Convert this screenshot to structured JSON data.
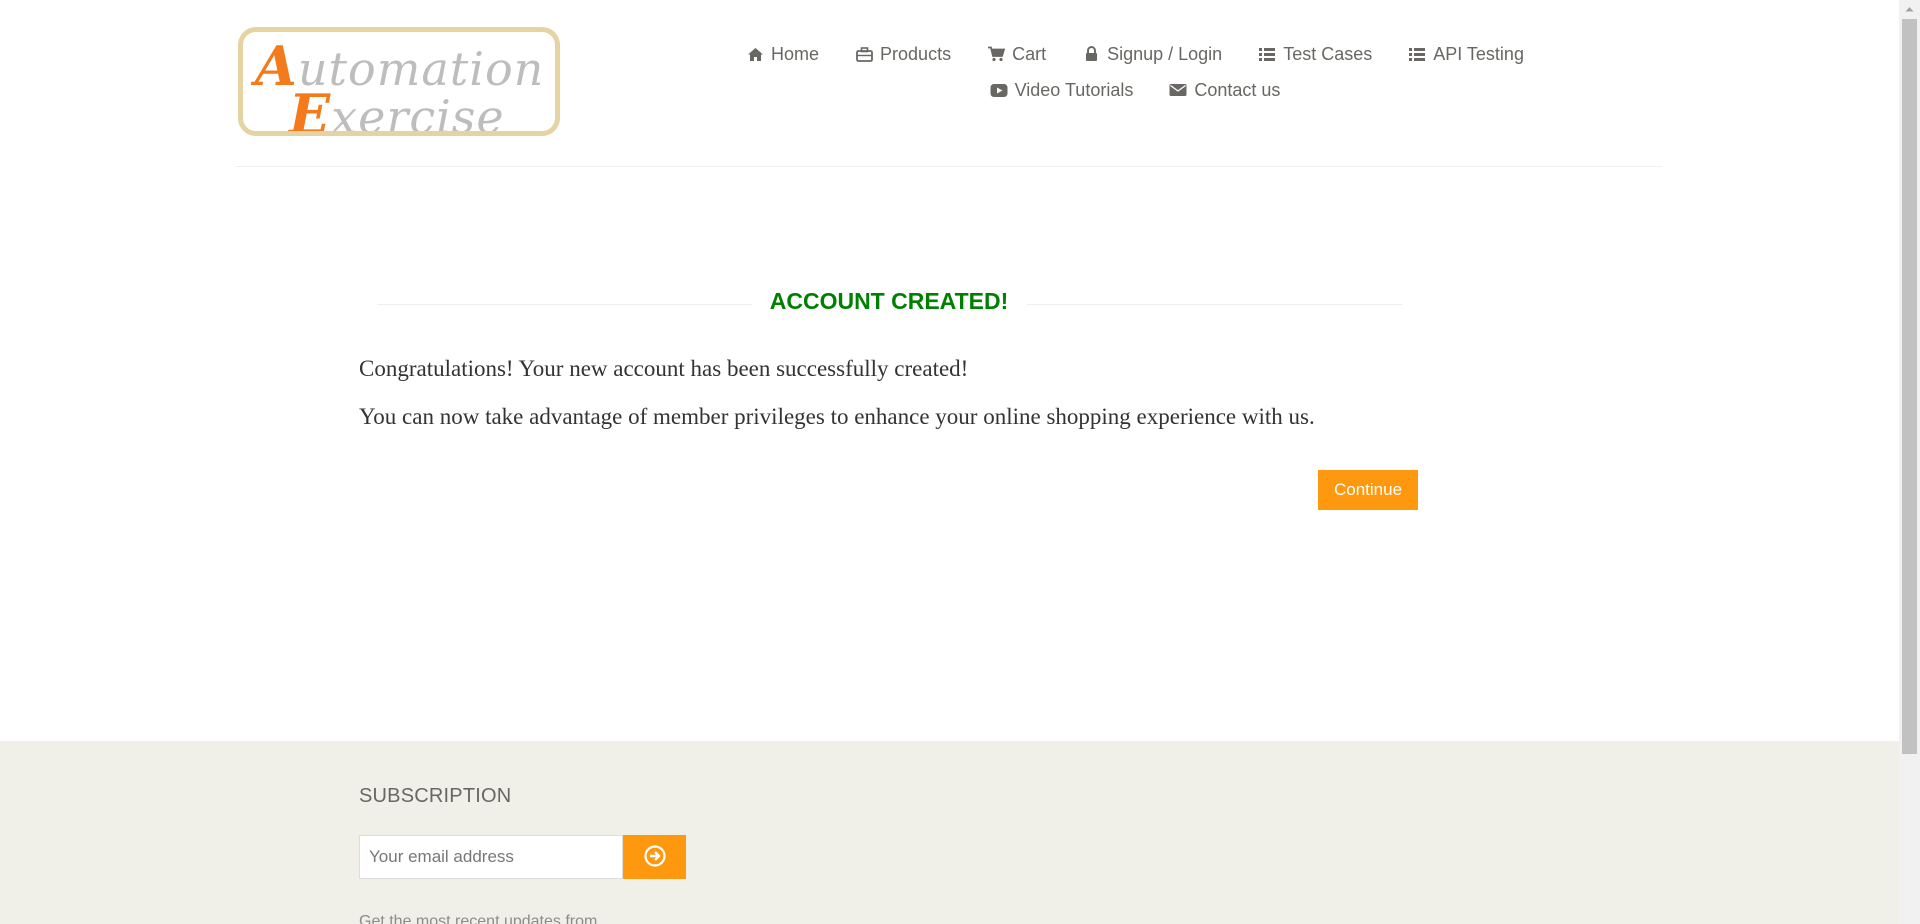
{
  "logo": {
    "line1_cap": "A",
    "line1_rest": "utomation",
    "line2_cap": "E",
    "line2_rest": "xercise"
  },
  "nav": {
    "row1": [
      {
        "label": "Home",
        "icon": "home-icon"
      },
      {
        "label": "Products",
        "icon": "briefcase-icon"
      },
      {
        "label": "Cart",
        "icon": "cart-icon"
      },
      {
        "label": "Signup / Login",
        "icon": "lock-icon"
      },
      {
        "label": "Test Cases",
        "icon": "list-icon"
      },
      {
        "label": "API Testing",
        "icon": "list-icon"
      }
    ],
    "row2": [
      {
        "label": "Video Tutorials",
        "icon": "youtube-play-icon"
      },
      {
        "label": "Contact us",
        "icon": "envelope-icon"
      }
    ]
  },
  "main": {
    "title": "ACCOUNT CREATED!",
    "message1": "Congratulations! Your new account has been successfully created!",
    "message2": "You can now take advantage of member privileges to enhance your online shopping experience with us.",
    "continue_label": "Continue"
  },
  "footer": {
    "subscription_title": "SUBSCRIPTION",
    "email_placeholder": "Your email address",
    "updates_text": "Get the most recent updates from"
  },
  "colors": {
    "accent_orange": "#fe980f",
    "title_green": "#008000",
    "footer_bg": "#f0f0e9",
    "nav_text": "#696763"
  }
}
